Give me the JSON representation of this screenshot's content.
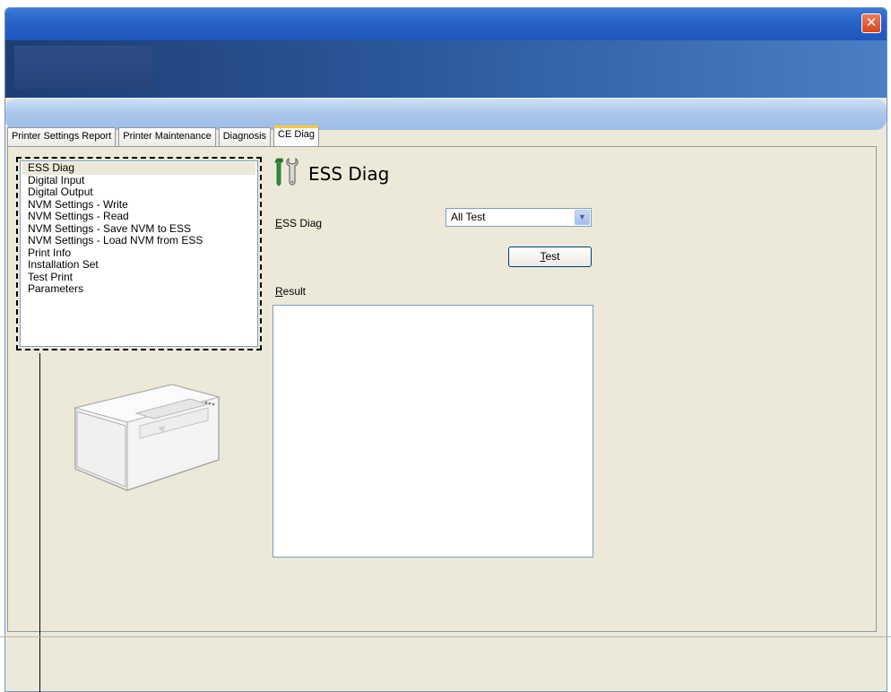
{
  "window": {
    "close_glyph": "✕"
  },
  "tabs": [
    {
      "label": "Printer Settings Report",
      "active": false
    },
    {
      "label": "Printer Maintenance",
      "active": false
    },
    {
      "label": "Diagnosis",
      "active": false
    },
    {
      "label": "CE Diag",
      "active": true
    }
  ],
  "menu": {
    "selected_index": 0,
    "items": [
      "ESS Diag",
      "Digital Input",
      "Digital Output",
      "NVM Settings - Write",
      "NVM Settings - Read",
      "NVM Settings - Save NVM to ESS",
      "NVM Settings - Load NVM from ESS",
      "Print Info",
      "Installation Set",
      "Test Print",
      "Parameters"
    ]
  },
  "panel": {
    "title": "ESS Diag",
    "title_icon": "tools-icon",
    "ess_diag_label_mnemonic": "E",
    "ess_diag_label_rest": "SS Diag",
    "ess_diag_select_value": "All Test",
    "test_button_mnemonic": "T",
    "test_button_rest": "est",
    "result_label_mnemonic": "R",
    "result_label_rest": "esult",
    "result_value": ""
  },
  "colors": {
    "title_bar": "#2a64c8",
    "tab_highlight": "#ffc83c",
    "panel_bg": "#ece9d8",
    "close_button": "#d8451e"
  }
}
